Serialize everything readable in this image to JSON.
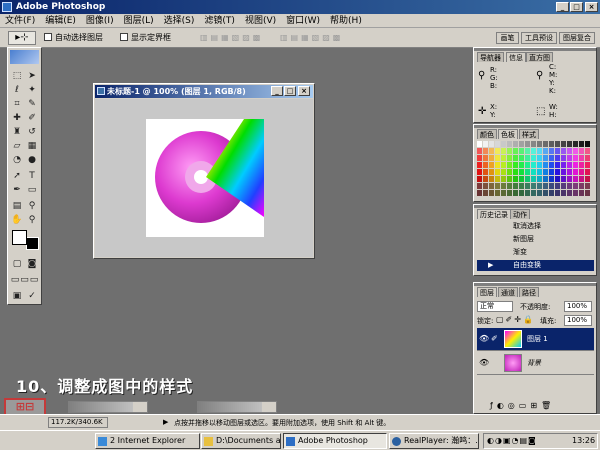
{
  "app": {
    "title": "Adobe Photoshop"
  },
  "menu": [
    "文件(F)",
    "编辑(E)",
    "图像(I)",
    "图层(L)",
    "选择(S)",
    "滤镜(T)",
    "视图(V)",
    "窗口(W)",
    "帮助(H)"
  ],
  "options": {
    "auto_select": "自动选择图层",
    "show_bounds": "显示定界框",
    "right_tabs": [
      "画笔",
      "工具预设",
      "图层复合"
    ]
  },
  "document": {
    "title": "未标题-1 @ 100% (图层 1, RGB/8)"
  },
  "navigator": {
    "tabs": [
      "导航器",
      "信息",
      "直方图"
    ],
    "rgb_labels": [
      "R:",
      "G:",
      "B:"
    ],
    "cmyk_labels": [
      "C:",
      "M:",
      "Y:",
      "K:"
    ],
    "xy_labels": [
      "X:",
      "Y:"
    ],
    "wh_labels": [
      "W:",
      "H:"
    ]
  },
  "color_panel": {
    "tabs": [
      "颜色",
      "色板",
      "样式"
    ]
  },
  "history": {
    "tabs": [
      "历史记录",
      "动作"
    ],
    "items": [
      "取消选择",
      "新图层",
      "渐变",
      "自由变换"
    ]
  },
  "layers": {
    "tabs": [
      "图层",
      "通道",
      "路径"
    ],
    "blend_mode": "正常",
    "opacity_label": "不透明度:",
    "opacity_value": "100%",
    "lock_label": "锁定:",
    "fill_label": "填充:",
    "fill_value": "100%",
    "items": [
      {
        "name": "图层 1",
        "selected": true
      },
      {
        "name": "背景",
        "selected": false
      }
    ]
  },
  "status": {
    "size": "117.2K/340.6K",
    "hint": "点按并拖移以移动图层或选区。要用附加选项，使用 Shift 和 Alt 键。"
  },
  "taskbar": {
    "items": [
      "2 Internet Explorer",
      "D:\\Documents and Se...",
      "Adobe Photoshop",
      "RealPlayer: 瀚鸣：..."
    ],
    "time": "13:26"
  },
  "caption": "10、调整成图中的样式",
  "colors": {
    "titlebar": "#0a246a",
    "selection": "#0a246a",
    "workspace": "#6f6f6f"
  }
}
